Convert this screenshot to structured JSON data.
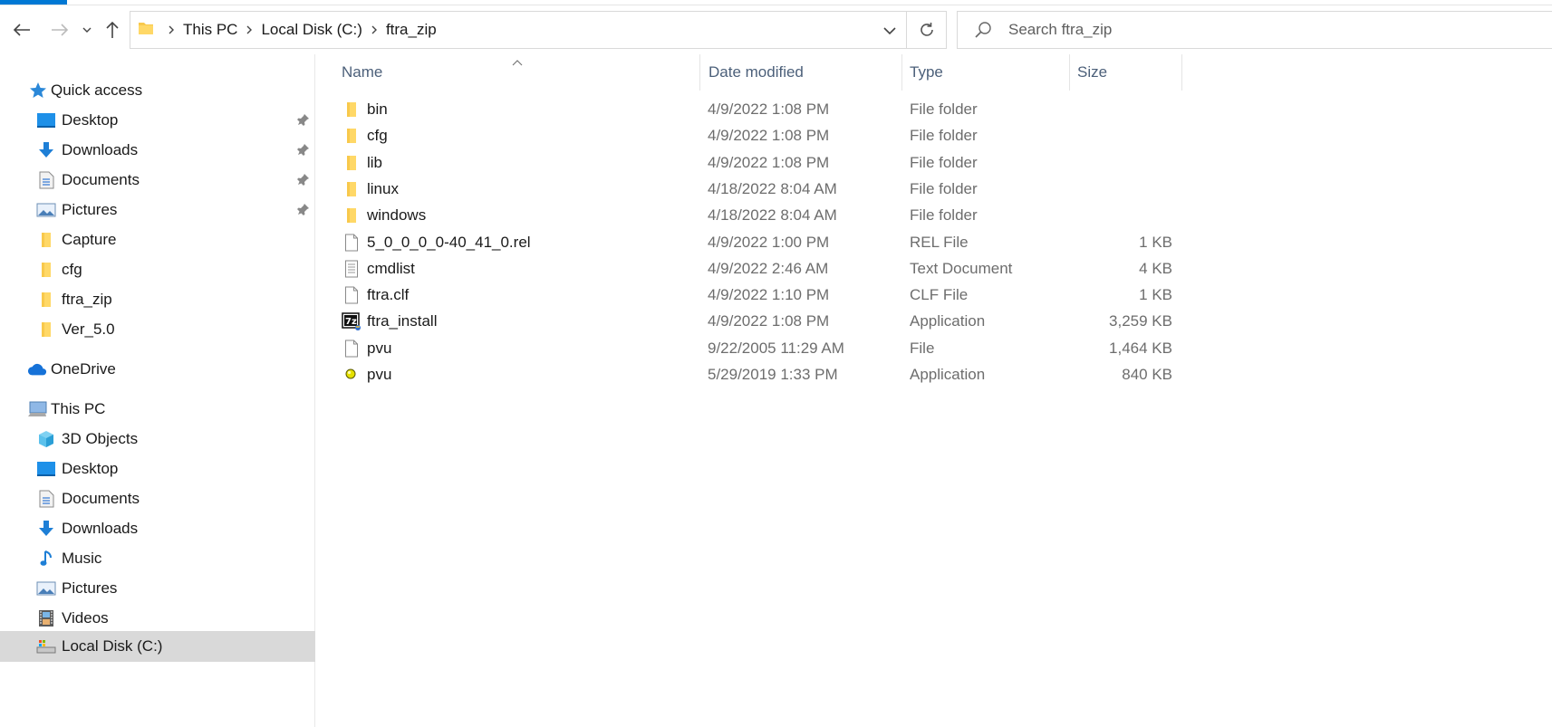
{
  "address": {
    "crumbs": [
      "This PC",
      "Local Disk (C:)",
      "ftra_zip"
    ]
  },
  "search": {
    "placeholder": "Search ftra_zip"
  },
  "sidebar": {
    "quick_access": "Quick access",
    "quick_items": [
      {
        "label": "Desktop",
        "icon": "desktop-icon",
        "pinned": true
      },
      {
        "label": "Downloads",
        "icon": "download-icon",
        "pinned": true
      },
      {
        "label": "Documents",
        "icon": "document-icon",
        "pinned": true
      },
      {
        "label": "Pictures",
        "icon": "pictures-icon",
        "pinned": true
      },
      {
        "label": "Capture",
        "icon": "folder-icon",
        "pinned": false
      },
      {
        "label": "cfg",
        "icon": "folder-icon",
        "pinned": false
      },
      {
        "label": "ftra_zip",
        "icon": "folder-icon",
        "pinned": false
      },
      {
        "label": "Ver_5.0",
        "icon": "folder-icon",
        "pinned": false
      }
    ],
    "onedrive": "OneDrive",
    "this_pc": "This PC",
    "pc_items": [
      {
        "label": "3D Objects",
        "icon": "3d-objects-icon"
      },
      {
        "label": "Desktop",
        "icon": "desktop-icon"
      },
      {
        "label": "Documents",
        "icon": "document-icon"
      },
      {
        "label": "Downloads",
        "icon": "download-icon"
      },
      {
        "label": "Music",
        "icon": "music-icon"
      },
      {
        "label": "Pictures",
        "icon": "pictures-icon"
      },
      {
        "label": "Videos",
        "icon": "videos-icon"
      },
      {
        "label": "Local Disk (C:)",
        "icon": "drive-icon",
        "selected": true
      }
    ]
  },
  "columns": {
    "name": "Name",
    "date": "Date modified",
    "type": "Type",
    "size": "Size"
  },
  "files": [
    {
      "name": "bin",
      "date": "4/9/2022 1:08 PM",
      "type": "File folder",
      "size": "",
      "icon": "folder-icon"
    },
    {
      "name": "cfg",
      "date": "4/9/2022 1:08 PM",
      "type": "File folder",
      "size": "",
      "icon": "folder-icon"
    },
    {
      "name": "lib",
      "date": "4/9/2022 1:08 PM",
      "type": "File folder",
      "size": "",
      "icon": "folder-icon"
    },
    {
      "name": "linux",
      "date": "4/18/2022 8:04 AM",
      "type": "File folder",
      "size": "",
      "icon": "folder-icon"
    },
    {
      "name": "windows",
      "date": "4/18/2022 8:04 AM",
      "type": "File folder",
      "size": "",
      "icon": "folder-icon"
    },
    {
      "name": "5_0_0_0_0-40_41_0.rel",
      "date": "4/9/2022 1:00 PM",
      "type": "REL File",
      "size": "1 KB",
      "icon": "blank-file-icon"
    },
    {
      "name": "cmdlist",
      "date": "4/9/2022 2:46 AM",
      "type": "Text Document",
      "size": "4 KB",
      "icon": "text-file-icon"
    },
    {
      "name": "ftra.clf",
      "date": "4/9/2022 1:10 PM",
      "type": "CLF File",
      "size": "1 KB",
      "icon": "blank-file-icon"
    },
    {
      "name": "ftra_install",
      "date": "4/9/2022 1:08 PM",
      "type": "Application",
      "size": "3,259 KB",
      "icon": "7zip-installer-icon"
    },
    {
      "name": "pvu",
      "date": "9/22/2005 11:29 AM",
      "type": "File",
      "size": "1,464 KB",
      "icon": "blank-file-icon"
    },
    {
      "name": "pvu",
      "date": "5/29/2019 1:33 PM",
      "type": "Application",
      "size": "840 KB",
      "icon": "app-ball-icon"
    }
  ],
  "colors": {
    "accent": "#0078d4",
    "folder": "#f8c94c",
    "selected_bg": "#d9d9d9",
    "header_text": "#4c607a"
  }
}
